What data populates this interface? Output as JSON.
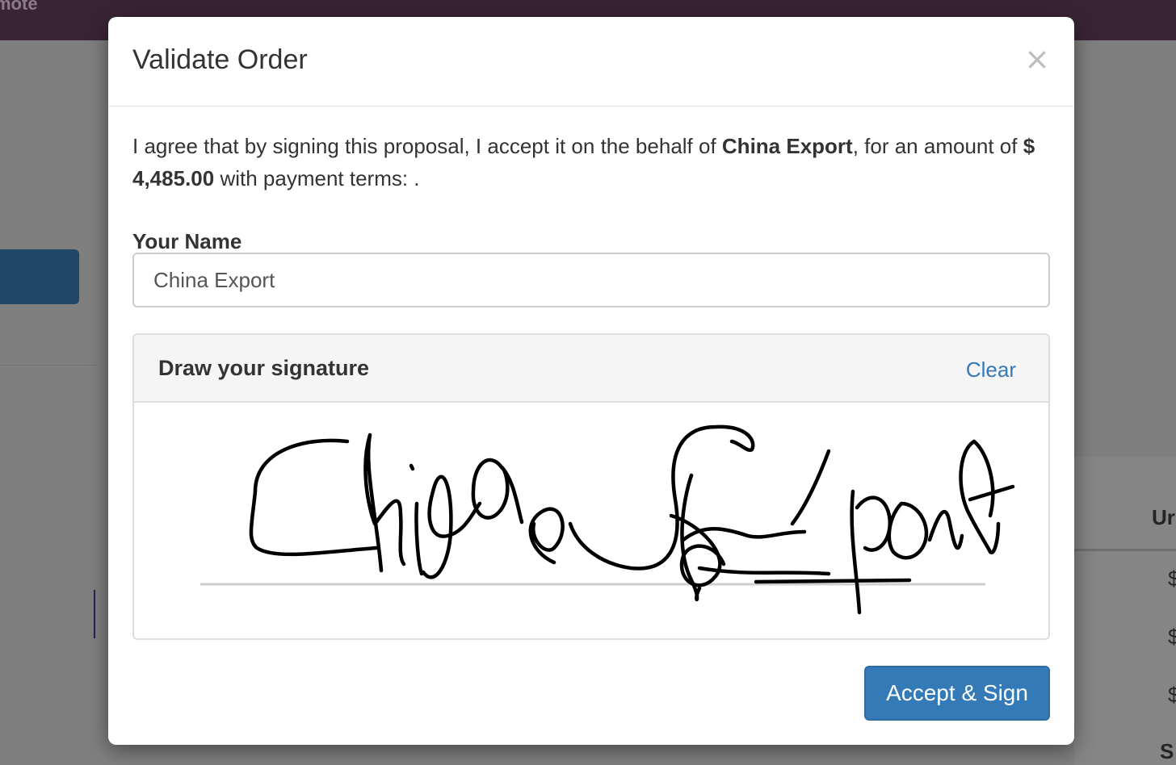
{
  "background": {
    "brand_fragment": "mote",
    "table_header_fragment": "Ur",
    "currency_fragments": [
      "$",
      "$",
      "$"
    ],
    "footer_fragment": "S"
  },
  "modal": {
    "title": "Validate Order",
    "close_glyph": "×",
    "agreement": {
      "prefix": "I agree that by signing this proposal, I accept it on the behalf of ",
      "company": "China Export",
      "middle": ", for an amount of ",
      "amount": "$ 4,485.00",
      "suffix": " with payment terms: ."
    },
    "name_label": "Your Name",
    "name_value": "China Export",
    "signature": {
      "heading": "Draw your signature",
      "clear_label": "Clear",
      "signed_text": "China Export"
    },
    "accept_label": "Accept & Sign"
  },
  "colors": {
    "primary": "#337ab7",
    "topbar": "#3a2434",
    "overlay": "#7f7f7f"
  }
}
